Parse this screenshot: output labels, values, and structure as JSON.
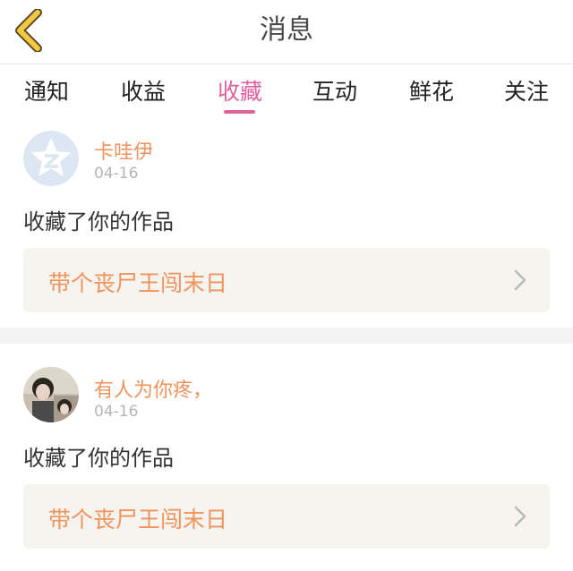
{
  "header": {
    "title": "消息",
    "back_icon": "chevron-left-icon",
    "back_color": "#f5c842"
  },
  "tabs": [
    {
      "label": "通知"
    },
    {
      "label": "收益"
    },
    {
      "label": "收藏",
      "active": true
    },
    {
      "label": "互动"
    },
    {
      "label": "鲜花"
    },
    {
      "label": "关注"
    }
  ],
  "messages": [
    {
      "username": "卡哇伊",
      "date": "04-16",
      "action": "收藏了你的作品",
      "work_title": "带个丧尸王闯末日",
      "avatar": "default-avatar-icon"
    },
    {
      "username": "有人为你疼，",
      "date": "04-16",
      "action": "收藏了你的作品",
      "work_title": "带个丧尸王闯末日",
      "avatar": "user-photo-avatar"
    }
  ],
  "colors": {
    "accent": "#e0609c",
    "username": "#f0935e",
    "work_title": "#f0935e",
    "work_bg": "#f5f4ef"
  }
}
